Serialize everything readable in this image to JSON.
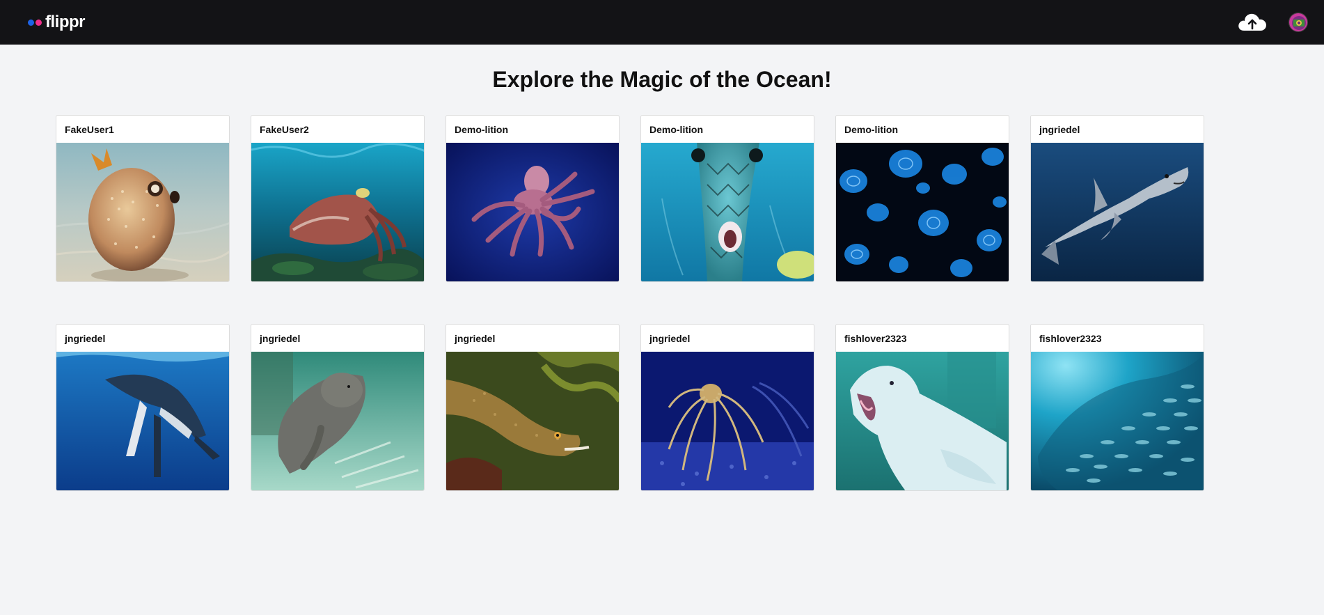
{
  "app": {
    "name": "flippr",
    "brand_colors": {
      "dot_left": "#1e63e6",
      "dot_right": "#ef2d8a",
      "topbar_bg": "#131316"
    }
  },
  "header": {
    "upload_icon": "cloud-upload-icon",
    "avatar_icon": "user-avatar"
  },
  "main": {
    "title": "Explore the Magic of the Ocean!"
  },
  "posts": [
    {
      "user": "FakeUser1",
      "subject": "pufferfish"
    },
    {
      "user": "FakeUser2",
      "subject": "cuttlefish"
    },
    {
      "user": "Demo-lition",
      "subject": "octopus"
    },
    {
      "user": "Demo-lition",
      "subject": "boxfish"
    },
    {
      "user": "Demo-lition",
      "subject": "jellyfish"
    },
    {
      "user": "jngriedel",
      "subject": "shark"
    },
    {
      "user": "jngriedel",
      "subject": "humpback-whale"
    },
    {
      "user": "jngriedel",
      "subject": "manatee"
    },
    {
      "user": "jngriedel",
      "subject": "moray-eel"
    },
    {
      "user": "jngriedel",
      "subject": "spider-crab"
    },
    {
      "user": "fishlover2323",
      "subject": "beluga-whale"
    },
    {
      "user": "fishlover2323",
      "subject": "fish-school"
    }
  ]
}
